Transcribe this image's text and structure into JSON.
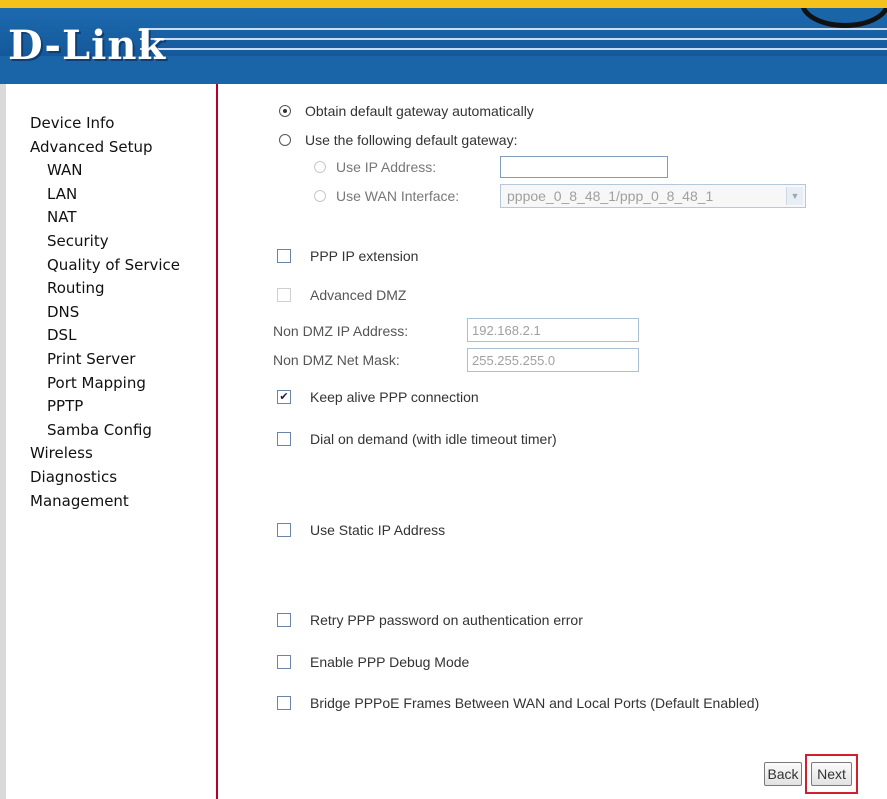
{
  "brand": {
    "logo_text": "D-Link"
  },
  "sidebar": {
    "items": [
      {
        "label": "Device Info",
        "level": "top"
      },
      {
        "label": "Advanced Setup",
        "level": "top"
      },
      {
        "label": "WAN",
        "level": "sub"
      },
      {
        "label": "LAN",
        "level": "sub"
      },
      {
        "label": "NAT",
        "level": "sub"
      },
      {
        "label": "Security",
        "level": "sub"
      },
      {
        "label": "Quality of Service",
        "level": "sub"
      },
      {
        "label": "Routing",
        "level": "sub"
      },
      {
        "label": "DNS",
        "level": "sub"
      },
      {
        "label": "DSL",
        "level": "sub"
      },
      {
        "label": "Print Server",
        "level": "sub"
      },
      {
        "label": "Port Mapping",
        "level": "sub"
      },
      {
        "label": "PPTP",
        "level": "sub"
      },
      {
        "label": "Samba Config",
        "level": "sub"
      },
      {
        "label": "Wireless",
        "level": "top"
      },
      {
        "label": "Diagnostics",
        "level": "top"
      },
      {
        "label": "Management",
        "level": "top"
      }
    ]
  },
  "gateway": {
    "obtain_auto_label": "Obtain default gateway automatically",
    "obtain_auto_selected": true,
    "use_following_label": "Use the following default gateway:",
    "use_ip_label": "Use IP Address:",
    "use_ip_value": "",
    "use_wan_label": "Use WAN Interface:",
    "use_wan_value": "pppoe_0_8_48_1/ppp_0_8_48_1"
  },
  "options": {
    "ppp_ip_extension_label": "PPP IP extension",
    "ppp_ip_extension_checked": false,
    "advanced_dmz_label": "Advanced DMZ",
    "advanced_dmz_checked": false,
    "non_dmz_ip_label": "Non DMZ IP Address:",
    "non_dmz_ip_value": "192.168.2.1",
    "non_dmz_mask_label": "Non DMZ Net Mask:",
    "non_dmz_mask_value": "255.255.255.0",
    "keep_alive_label": "Keep alive PPP connection",
    "keep_alive_checked": true,
    "dial_on_demand_label": "Dial on demand (with idle timeout timer)",
    "dial_on_demand_checked": false,
    "static_ip_label": "Use Static IP Address",
    "static_ip_checked": false,
    "retry_password_label": "Retry PPP password on authentication error",
    "retry_password_checked": false,
    "debug_mode_label": "Enable PPP Debug Mode",
    "debug_mode_checked": false,
    "bridge_pppoe_label": "Bridge PPPoE Frames Between WAN and Local Ports (Default Enabled)",
    "bridge_pppoe_checked": false
  },
  "buttons": {
    "back_label": "Back",
    "next_label": "Next"
  },
  "colors": {
    "brand_blue": "#1a64a8",
    "accent_yellow": "#f4c21a",
    "divider_red": "#b5002a",
    "highlight_red": "#d02030"
  }
}
